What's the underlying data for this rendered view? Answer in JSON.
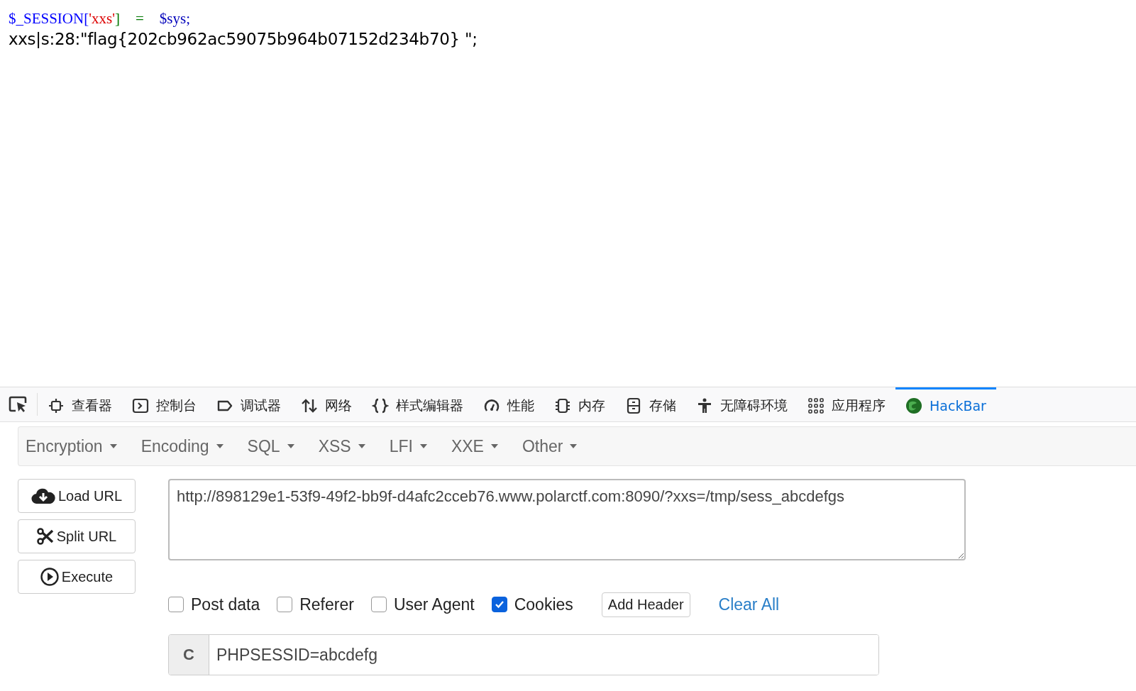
{
  "code_line": [
    {
      "text": "$_SESSION[",
      "color": "#0000ff"
    },
    {
      "text": "'xxs'",
      "color": "#dd0000"
    },
    {
      "text": "]",
      "color": "#007700"
    },
    {
      "text": "=",
      "color": "#007700"
    },
    {
      "text": "$sys;",
      "color": "#0000bb"
    }
  ],
  "output": "xxs|s:28:\"flag{202cb962ac59075b964b07152d234b70} \";",
  "devtools_tabs": [
    {
      "kind": "inspector",
      "label": "查看器",
      "selected": false
    },
    {
      "kind": "console",
      "label": "控制台",
      "selected": false
    },
    {
      "kind": "debugger",
      "label": "调试器",
      "selected": false
    },
    {
      "kind": "network",
      "label": "网络",
      "selected": false
    },
    {
      "kind": "style",
      "label": "样式编辑器",
      "selected": false
    },
    {
      "kind": "performance",
      "label": "性能",
      "selected": false
    },
    {
      "kind": "memory",
      "label": "内存",
      "selected": false
    },
    {
      "kind": "storage",
      "label": "存储",
      "selected": false
    },
    {
      "kind": "accessibility",
      "label": "无障碍环境",
      "selected": false
    },
    {
      "kind": "apps",
      "label": "应用程序",
      "selected": false
    },
    {
      "kind": "hackbar",
      "label": "HackBar",
      "selected": true
    }
  ],
  "menu": [
    "Encryption",
    "Encoding",
    "SQL",
    "XSS",
    "LFI",
    "XXE",
    "Other"
  ],
  "buttons": [
    {
      "kind": "load",
      "label": "Load URL"
    },
    {
      "kind": "split",
      "label": "Split URL"
    },
    {
      "kind": "execute",
      "label": "Execute"
    }
  ],
  "url": "http://898129e1-53f9-49f2-bb9f-d4afc2cceb76.www.polarctf.com:8090/?xxs=/tmp/sess_abcdefgs",
  "options": [
    {
      "label": "Post data",
      "checked": false
    },
    {
      "label": "Referer",
      "checked": false
    },
    {
      "label": "User Agent",
      "checked": false
    },
    {
      "label": "Cookies",
      "checked": true
    }
  ],
  "add_header": "Add Header",
  "clear_all": "Clear All",
  "cookie": {
    "prefix": "C",
    "value": "PHPSESSID=abcdefg"
  }
}
